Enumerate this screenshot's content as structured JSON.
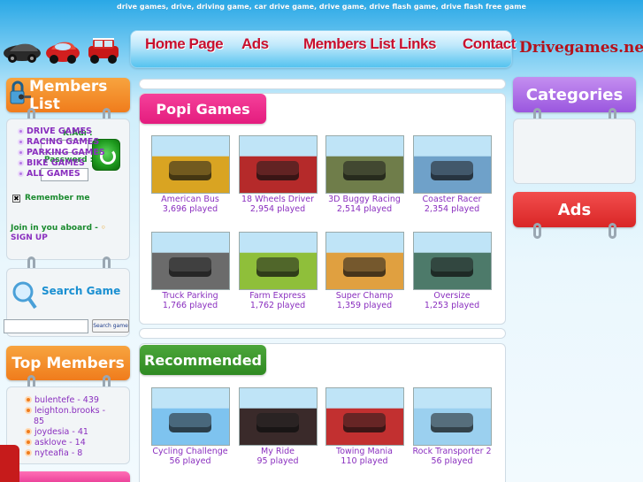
{
  "header": {
    "keywords": "drive games, drive, driving game, car drive game, drive game, drive flash game, drive flash free game",
    "site_name": "Drivegames.net"
  },
  "nav": [
    {
      "label": "Home Page"
    },
    {
      "label": "Ads"
    },
    {
      "label": "Members List"
    },
    {
      "label": "Links"
    },
    {
      "label": "Contact"
    }
  ],
  "login": {
    "title": "Members List",
    "username_label": "K.Adı :",
    "password_label": "Password :",
    "remember": "Remember me",
    "join_text": "Join in you aboard -",
    "signup": "SIGN UP"
  },
  "search": {
    "title": "Search Game",
    "button": "Search game"
  },
  "top_members": {
    "title": "Top Members",
    "items": [
      {
        "text": "bulentefe - 439"
      },
      {
        "text": "leighton.brooks -"
      },
      {
        "text": "85"
      },
      {
        "text": "joydesia - 41"
      },
      {
        "text": "asklove - 14"
      },
      {
        "text": "nyteafia - 8"
      }
    ]
  },
  "popi": {
    "title": "Popi Games",
    "games": [
      {
        "name": "American Bus",
        "played": "3,696 played",
        "theme": "#d9a422"
      },
      {
        "name": "18 Wheels Driver",
        "played": "2,954 played",
        "theme": "#b52a2a"
      },
      {
        "name": "3D Buggy Racing",
        "played": "2,514 played",
        "theme": "#6f7d4a"
      },
      {
        "name": "Coaster Racer",
        "played": "2,354 played",
        "theme": "#6fa1c9"
      },
      {
        "name": "Truck Parking",
        "played": "1,766 played",
        "theme": "#6b6b6b"
      },
      {
        "name": "Farm Express",
        "played": "1,762 played",
        "theme": "#8fbf3a"
      },
      {
        "name": "Super Champ",
        "played": "1,359 played",
        "theme": "#e0a040"
      },
      {
        "name": "Oversize",
        "played": "1,253 played",
        "theme": "#4d7a6a"
      }
    ]
  },
  "recommended": {
    "title": "Recommended",
    "games": [
      {
        "name": "Cycling Challenge",
        "played": "56 played",
        "theme": "#7ec3ef"
      },
      {
        "name": "My Ride",
        "played": "95 played",
        "theme": "#3a2a2a"
      },
      {
        "name": "Towing Mania",
        "played": "110 played",
        "theme": "#c23030"
      },
      {
        "name": "Rock Transporter 2",
        "played": "56 played",
        "theme": "#9bd0ef"
      }
    ]
  },
  "categories": {
    "title": "Categories",
    "items": [
      {
        "label": "DRIVE GAMES"
      },
      {
        "label": "RACING GAMES"
      },
      {
        "label": "PARKING GAMES"
      },
      {
        "label": "BIKE GAMES"
      },
      {
        "label": "ALL GAMES"
      }
    ]
  },
  "ads": {
    "title": "Ads"
  },
  "colors": {
    "nav_text": "#c8102e",
    "link_purple": "#8a2fbf",
    "orange": "#f07c1c",
    "pink": "#e41c7e",
    "green": "#2f8a22",
    "violet": "#9a57df",
    "red": "#d92626"
  }
}
